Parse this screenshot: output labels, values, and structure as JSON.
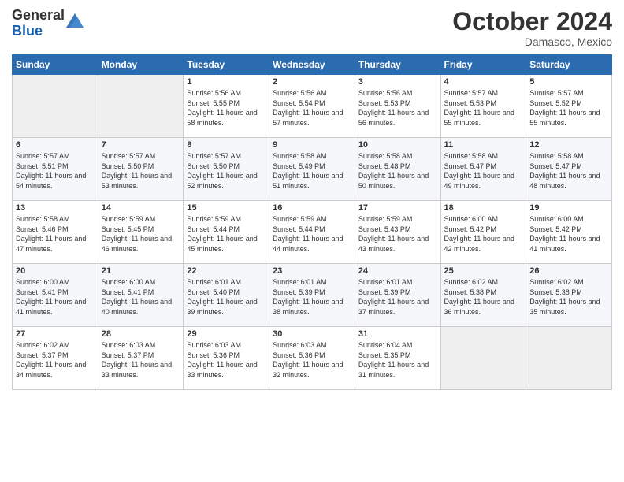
{
  "header": {
    "logo_general": "General",
    "logo_blue": "Blue",
    "month": "October 2024",
    "location": "Damasco, Mexico"
  },
  "weekdays": [
    "Sunday",
    "Monday",
    "Tuesday",
    "Wednesday",
    "Thursday",
    "Friday",
    "Saturday"
  ],
  "weeks": [
    [
      {
        "day": "",
        "info": ""
      },
      {
        "day": "",
        "info": ""
      },
      {
        "day": "1",
        "info": "Sunrise: 5:56 AM\nSunset: 5:55 PM\nDaylight: 11 hours and 58 minutes."
      },
      {
        "day": "2",
        "info": "Sunrise: 5:56 AM\nSunset: 5:54 PM\nDaylight: 11 hours and 57 minutes."
      },
      {
        "day": "3",
        "info": "Sunrise: 5:56 AM\nSunset: 5:53 PM\nDaylight: 11 hours and 56 minutes."
      },
      {
        "day": "4",
        "info": "Sunrise: 5:57 AM\nSunset: 5:53 PM\nDaylight: 11 hours and 55 minutes."
      },
      {
        "day": "5",
        "info": "Sunrise: 5:57 AM\nSunset: 5:52 PM\nDaylight: 11 hours and 55 minutes."
      }
    ],
    [
      {
        "day": "6",
        "info": "Sunrise: 5:57 AM\nSunset: 5:51 PM\nDaylight: 11 hours and 54 minutes."
      },
      {
        "day": "7",
        "info": "Sunrise: 5:57 AM\nSunset: 5:50 PM\nDaylight: 11 hours and 53 minutes."
      },
      {
        "day": "8",
        "info": "Sunrise: 5:57 AM\nSunset: 5:50 PM\nDaylight: 11 hours and 52 minutes."
      },
      {
        "day": "9",
        "info": "Sunrise: 5:58 AM\nSunset: 5:49 PM\nDaylight: 11 hours and 51 minutes."
      },
      {
        "day": "10",
        "info": "Sunrise: 5:58 AM\nSunset: 5:48 PM\nDaylight: 11 hours and 50 minutes."
      },
      {
        "day": "11",
        "info": "Sunrise: 5:58 AM\nSunset: 5:47 PM\nDaylight: 11 hours and 49 minutes."
      },
      {
        "day": "12",
        "info": "Sunrise: 5:58 AM\nSunset: 5:47 PM\nDaylight: 11 hours and 48 minutes."
      }
    ],
    [
      {
        "day": "13",
        "info": "Sunrise: 5:58 AM\nSunset: 5:46 PM\nDaylight: 11 hours and 47 minutes."
      },
      {
        "day": "14",
        "info": "Sunrise: 5:59 AM\nSunset: 5:45 PM\nDaylight: 11 hours and 46 minutes."
      },
      {
        "day": "15",
        "info": "Sunrise: 5:59 AM\nSunset: 5:44 PM\nDaylight: 11 hours and 45 minutes."
      },
      {
        "day": "16",
        "info": "Sunrise: 5:59 AM\nSunset: 5:44 PM\nDaylight: 11 hours and 44 minutes."
      },
      {
        "day": "17",
        "info": "Sunrise: 5:59 AM\nSunset: 5:43 PM\nDaylight: 11 hours and 43 minutes."
      },
      {
        "day": "18",
        "info": "Sunrise: 6:00 AM\nSunset: 5:42 PM\nDaylight: 11 hours and 42 minutes."
      },
      {
        "day": "19",
        "info": "Sunrise: 6:00 AM\nSunset: 5:42 PM\nDaylight: 11 hours and 41 minutes."
      }
    ],
    [
      {
        "day": "20",
        "info": "Sunrise: 6:00 AM\nSunset: 5:41 PM\nDaylight: 11 hours and 41 minutes."
      },
      {
        "day": "21",
        "info": "Sunrise: 6:00 AM\nSunset: 5:41 PM\nDaylight: 11 hours and 40 minutes."
      },
      {
        "day": "22",
        "info": "Sunrise: 6:01 AM\nSunset: 5:40 PM\nDaylight: 11 hours and 39 minutes."
      },
      {
        "day": "23",
        "info": "Sunrise: 6:01 AM\nSunset: 5:39 PM\nDaylight: 11 hours and 38 minutes."
      },
      {
        "day": "24",
        "info": "Sunrise: 6:01 AM\nSunset: 5:39 PM\nDaylight: 11 hours and 37 minutes."
      },
      {
        "day": "25",
        "info": "Sunrise: 6:02 AM\nSunset: 5:38 PM\nDaylight: 11 hours and 36 minutes."
      },
      {
        "day": "26",
        "info": "Sunrise: 6:02 AM\nSunset: 5:38 PM\nDaylight: 11 hours and 35 minutes."
      }
    ],
    [
      {
        "day": "27",
        "info": "Sunrise: 6:02 AM\nSunset: 5:37 PM\nDaylight: 11 hours and 34 minutes."
      },
      {
        "day": "28",
        "info": "Sunrise: 6:03 AM\nSunset: 5:37 PM\nDaylight: 11 hours and 33 minutes."
      },
      {
        "day": "29",
        "info": "Sunrise: 6:03 AM\nSunset: 5:36 PM\nDaylight: 11 hours and 33 minutes."
      },
      {
        "day": "30",
        "info": "Sunrise: 6:03 AM\nSunset: 5:36 PM\nDaylight: 11 hours and 32 minutes."
      },
      {
        "day": "31",
        "info": "Sunrise: 6:04 AM\nSunset: 5:35 PM\nDaylight: 11 hours and 31 minutes."
      },
      {
        "day": "",
        "info": ""
      },
      {
        "day": "",
        "info": ""
      }
    ]
  ]
}
